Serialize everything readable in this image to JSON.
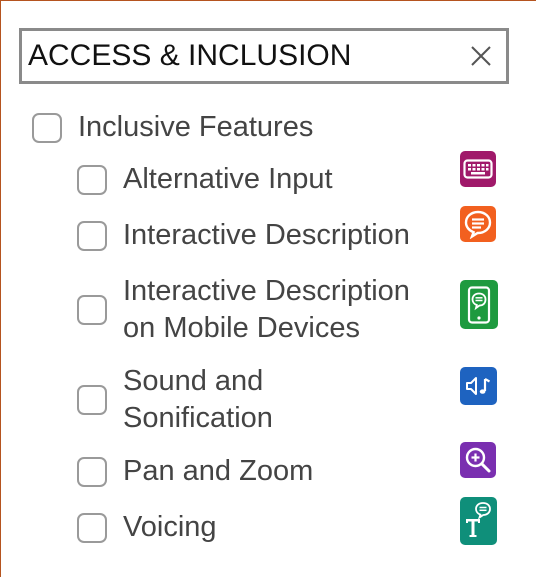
{
  "filter": {
    "title": "ACCESS & INCLUSION",
    "close_icon": "close-icon"
  },
  "parent": {
    "label": "Inclusive Features",
    "checked": false
  },
  "items": [
    {
      "label_line1": "Alternative Input",
      "label_line2": "",
      "icon": "keyboard-icon",
      "color": "#a0196a",
      "checked": false
    },
    {
      "label_line1": "Interactive Description",
      "label_line2": "",
      "icon": "speech-bubble-icon",
      "color": "#f2601f",
      "checked": false
    },
    {
      "label_line1": "Interactive Description",
      "label_line2": "on Mobile Devices",
      "icon": "mobile-description-icon",
      "color": "#1e9a3f",
      "checked": false
    },
    {
      "label_line1": "Sound and",
      "label_line2": "Sonification",
      "icon": "sound-icon",
      "color": "#1e63c0",
      "checked": false
    },
    {
      "label_line1": "Pan and Zoom",
      "label_line2": "",
      "icon": "zoom-icon",
      "color": "#7a2fb0",
      "checked": false
    },
    {
      "label_line1": "Voicing",
      "label_line2": "",
      "icon": "voicing-icon",
      "color": "#0f8f7a",
      "checked": false
    }
  ]
}
